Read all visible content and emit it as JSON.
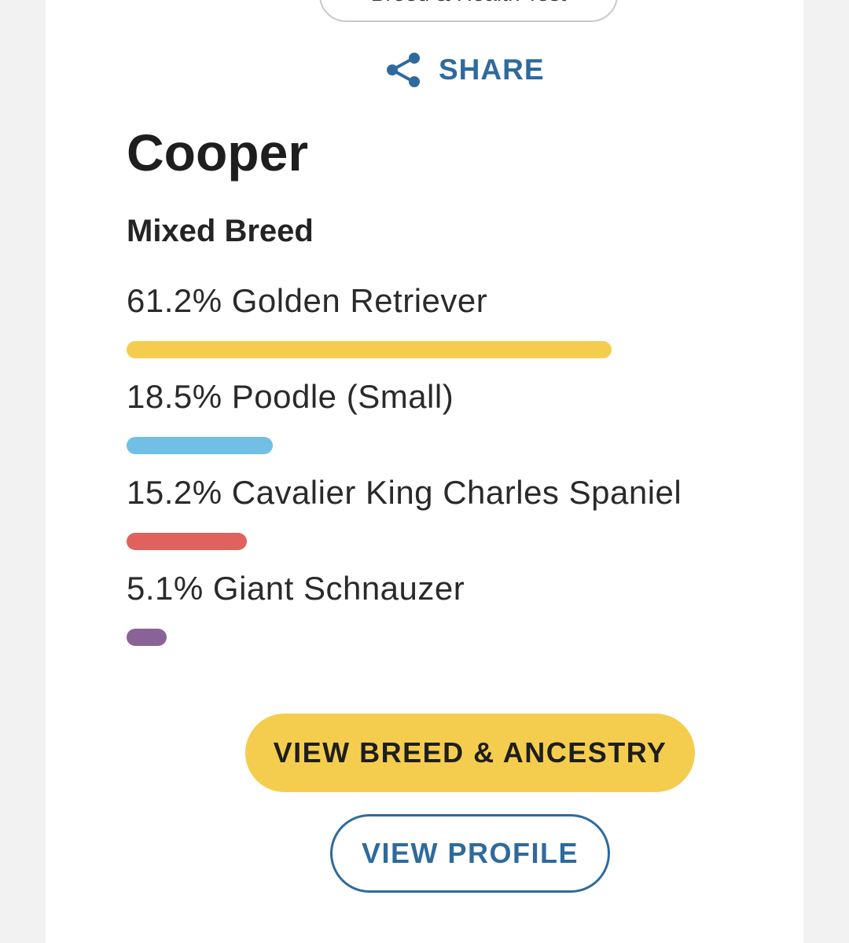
{
  "theme": {
    "accent_blue": "#2e6a9e",
    "button_yellow": "#f5cd4e"
  },
  "top_pill": {
    "label": "Breed & Health Test"
  },
  "share": {
    "label": "SHARE",
    "icon": "share-icon"
  },
  "dog": {
    "name": "Cooper",
    "breed_type": "Mixed Breed"
  },
  "breeds": [
    {
      "label": "61.2% Golden Retriever",
      "percent": 61.2,
      "color": "#f5cd4e"
    },
    {
      "label": "18.5% Poodle (Small)",
      "percent": 18.5,
      "color": "#72bfe6"
    },
    {
      "label": "15.2% Cavalier King Charles Spaniel",
      "percent": 15.2,
      "color": "#e0625e"
    },
    {
      "label": "5.1% Giant Schnauzer",
      "percent": 5.1,
      "color": "#8a6396"
    }
  ],
  "actions": {
    "primary_label": "VIEW BREED & ANCESTRY",
    "secondary_label": "VIEW PROFILE"
  }
}
